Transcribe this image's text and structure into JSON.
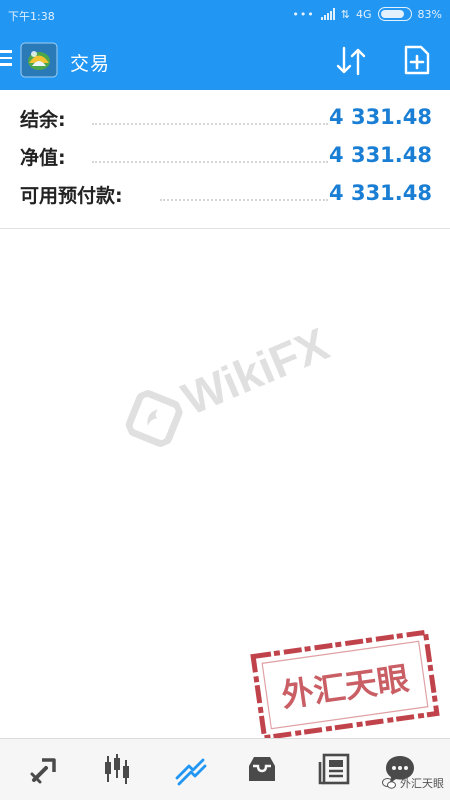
{
  "status_bar": {
    "time": "下午1:38",
    "network": "4G",
    "battery": "83%",
    "battery_level": 0.83
  },
  "app_bar": {
    "title": "交易"
  },
  "account": {
    "rows": [
      {
        "label": "结余:",
        "value": "4 331.48"
      },
      {
        "label": "净值:",
        "value": "4 331.48"
      },
      {
        "label": "可用预付款:",
        "value": "4 331.48"
      }
    ]
  },
  "watermark": {
    "text": "WikiFX"
  },
  "stamp": {
    "text": "外汇天眼"
  },
  "credit": {
    "text": "外汇天眼"
  },
  "bottom_nav": {
    "items": [
      {
        "icon": "quotes-icon",
        "active": false
      },
      {
        "icon": "chart-icon",
        "active": false
      },
      {
        "icon": "trade-icon",
        "active": true
      },
      {
        "icon": "history-icon",
        "active": false
      },
      {
        "icon": "news-icon",
        "active": false
      },
      {
        "icon": "chat-icon",
        "active": false
      }
    ]
  },
  "colors": {
    "accent": "#2196f3",
    "value": "#1a7fd4",
    "icon": "#4a4a4a",
    "stamp": "#c0434b"
  }
}
